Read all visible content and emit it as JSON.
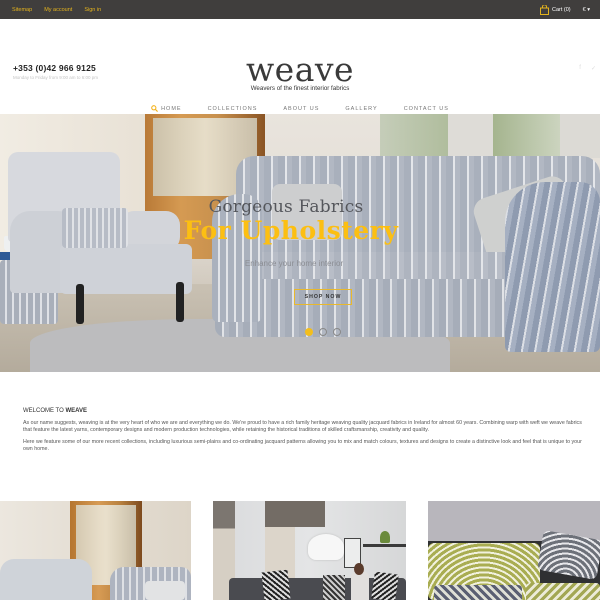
{
  "topbar": {
    "links": [
      "Sitemap",
      "My account",
      "Sign in"
    ],
    "cart_label": "Cart (0)",
    "cart_icon": "shopping-bag-icon",
    "currency": "€",
    "currency_icon": "chevron-down-icon"
  },
  "header": {
    "phone": "+353 (0)42 966 9125",
    "hours": "Monday to Friday from 9:00 am to 6:00 pm",
    "logo": "weave",
    "tagline": "Weavers of the finest interior fabrics",
    "social": [
      {
        "icon": "facebook-icon",
        "glyph": "f"
      },
      {
        "icon": "twitter-icon",
        "glyph": "✓"
      }
    ]
  },
  "nav": {
    "items": [
      "HOME",
      "COLLECTIONS",
      "ABOUT US",
      "GALLERY",
      "CONTACT US"
    ],
    "active_icon": "search-icon"
  },
  "hero": {
    "caption_line1": "Gorgeous Fabrics",
    "caption_line2": "For Upholstery",
    "caption_line3": "Enhance your home interior",
    "button": "SHOP NOW",
    "slides_total": 3,
    "active_slide": 1,
    "accent_color": "#fcbf12"
  },
  "welcome": {
    "heading_prefix": "WELCOME TO ",
    "heading_brand": "WEAVE",
    "paragraphs": [
      "As our name suggests, weaving is at the very heart of who we are and everything we do.  We're proud to have a rich family heritage weaving quality jacquard fabrics in Ireland for almost 60 years.  Combining warp with weft we weave fabrics that feature the latest yarns, contemporary designs and modern production technologies, while retaining the historical traditions of skilled craftsmanship, creativity and quality.",
      "Here we feature some of our more recent collections, including luxurious semi-plains and co-ordinating jacquard patterns allowing you to mix and match colours, textures and designs to create a distinctive look and feel that is unique to your own home."
    ]
  },
  "collections": [
    {
      "image": "armchair-cabinet-room"
    },
    {
      "image": "living-room-lamp-sofa"
    },
    {
      "image": "patterned-cushions"
    }
  ]
}
